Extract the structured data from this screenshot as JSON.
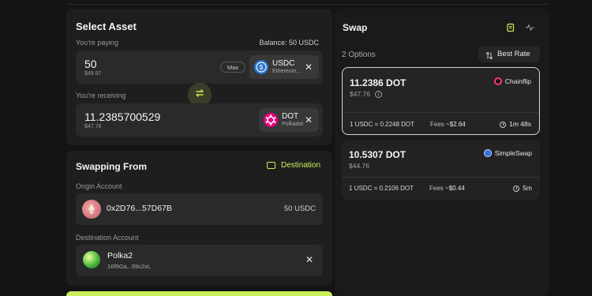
{
  "select_asset": {
    "title": "Select Asset",
    "paying_label": "You're paying",
    "balance": "Balance: 50 USDC",
    "pay_amount": "50",
    "pay_amount_usd": "$49.97",
    "max_label": "Max",
    "pay_token": {
      "symbol": "USDC",
      "network": "Ethereum...",
      "icon": "usdc-icon",
      "color": "#2775ca"
    },
    "receiving_label": "You're receiving",
    "receive_amount": "11.2385700529",
    "receive_amount_usd": "$47.76",
    "receive_token": {
      "symbol": "DOT",
      "network": "Polkadot",
      "icon": "polkadot-icon",
      "color": "#e6007a"
    }
  },
  "swapping_from": {
    "title": "Swapping From",
    "destination_label": "Destination",
    "origin_label": "Origin Account",
    "origin_address": "0x2D76...57D67B",
    "origin_balance": "50 USDC",
    "destination_account_label": "Destination Account",
    "dest_name": "Polka2",
    "dest_address": "16f9Ga...69c2xL"
  },
  "swap": {
    "title": "Swap",
    "options_count": "2 Options",
    "sort_label": "Best Rate",
    "options": [
      {
        "amount": "11.2386 DOT",
        "usd": "$47.76",
        "provider": "Chainflip",
        "rate": "1 USDC = 0.2248 DOT",
        "fees_label": "Fees",
        "fees": "~$2.64",
        "time": "1m 48s",
        "selected": true
      },
      {
        "amount": "10.5307 DOT",
        "usd": "$44.76",
        "provider": "SimpleSwap",
        "rate": "1 USDC = 0.2106 DOT",
        "fees_label": "Fees",
        "fees": "~$0.44",
        "time": "5m",
        "selected": false
      }
    ]
  },
  "colors": {
    "accent": "#c9ef5c",
    "background": "#141414",
    "panel": "#1e1e1e"
  }
}
